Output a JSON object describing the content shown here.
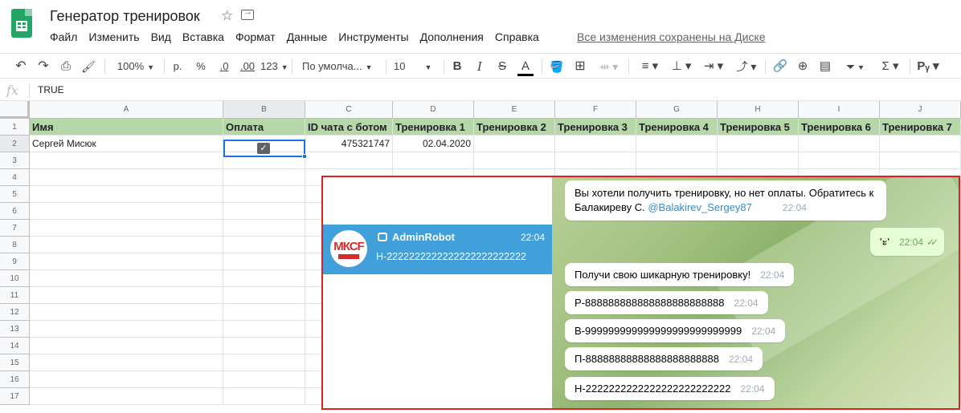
{
  "doc": {
    "title": "Генератор тренировок",
    "menu": [
      "Файл",
      "Изменить",
      "Вид",
      "Вставка",
      "Формат",
      "Данные",
      "Инструменты",
      "Дополнения",
      "Справка"
    ],
    "saved_status": "Все изменения сохранены на Диске"
  },
  "toolbar": {
    "zoom": "100%",
    "currency": "р.",
    "percent": "%",
    "dec_decrease": ".0",
    "dec_increase": ".00",
    "format_more": "123",
    "font": "По умолча...",
    "font_size": "10"
  },
  "formula_bar": {
    "fx": "fx",
    "value": "TRUE"
  },
  "sheet": {
    "columns": [
      "A",
      "B",
      "C",
      "D",
      "E",
      "F",
      "G",
      "H",
      "I",
      "J"
    ],
    "rows": [
      "1",
      "2",
      "3",
      "4",
      "5",
      "6",
      "7",
      "8",
      "9",
      "10",
      "11",
      "12",
      "13",
      "14",
      "15",
      "16",
      "17"
    ],
    "header_row": [
      "Имя",
      "Оплата",
      "ID чата с ботом",
      "Тренировка 1",
      "Тренировка 2",
      "Тренировка 3",
      "Тренировка 4",
      "Тренировка 5",
      "Тренировка 6",
      "Тренировка 7"
    ],
    "data_row": {
      "name": "Сергей Мисюк",
      "paid": true,
      "chat_id": "475321747",
      "training1": "02.04.2020"
    }
  },
  "telegram": {
    "chat": {
      "name": "AdminRobot",
      "time": "22:04",
      "preview": "Н-2222222222222222222222222",
      "avatar_text": "МКСF"
    },
    "messages": [
      {
        "line1": "Вы хотели получить тренировку, но нет оплаты. Обратитесь к",
        "line2_prefix": "Балакиреву С. ",
        "mention": "@Balakirev_Sergey87",
        "time": "22:04"
      },
      {
        "text": "'ะ'",
        "time": "22:04",
        "outgoing": true
      },
      {
        "text": "Получи свою шикарную тренировку!",
        "time": "22:04"
      },
      {
        "text": "Р-888888888888888888888888",
        "time": "22:04"
      },
      {
        "text": "В-999999999999999999999999999",
        "time": "22:04"
      },
      {
        "text": "П-88888888888888888888888",
        "time": "22:04"
      },
      {
        "text": "Н-2222222222222222222222222",
        "time": "22:04"
      }
    ]
  },
  "colors": {
    "header_fill": "#b6d7a8",
    "selection": "#1a73e8",
    "chat_selected": "#419fd9",
    "overlay_border": "#e02020"
  }
}
